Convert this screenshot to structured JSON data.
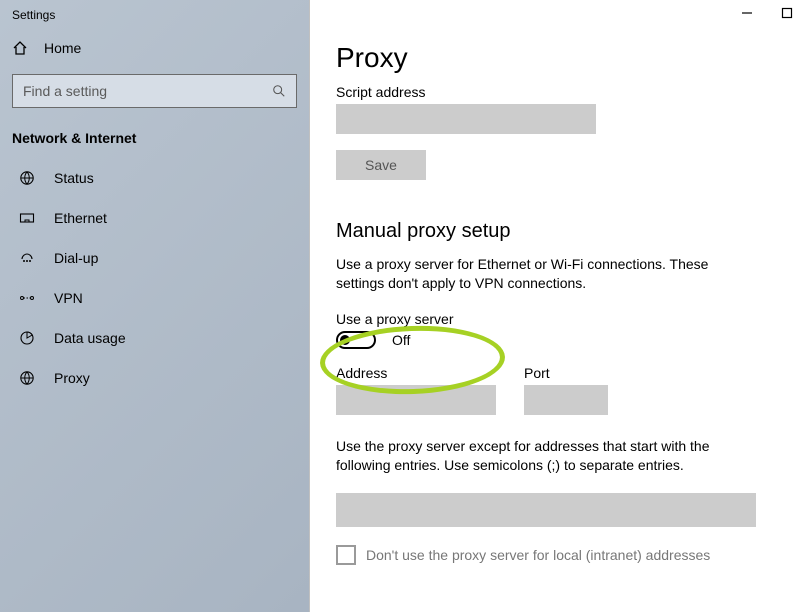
{
  "app_title": "Settings",
  "home_label": "Home",
  "search": {
    "placeholder": "Find a setting"
  },
  "section": "Network & Internet",
  "nav": {
    "status": "Status",
    "ethernet": "Ethernet",
    "dialup": "Dial-up",
    "vpn": "VPN",
    "datausage": "Data usage",
    "proxy": "Proxy"
  },
  "page": {
    "title": "Proxy",
    "script_label": "Script address",
    "save_label": "Save",
    "manual_title": "Manual proxy setup",
    "manual_desc": "Use a proxy server for Ethernet or Wi-Fi connections. These settings don't apply to VPN connections.",
    "toggle_label": "Use a proxy server",
    "toggle_state": "Off",
    "address_label": "Address",
    "port_label": "Port",
    "exceptions_desc": "Use the proxy server except for addresses that start with the following entries. Use semicolons (;) to separate entries.",
    "local_checkbox": "Don't use the proxy server for local (intranet) addresses"
  }
}
